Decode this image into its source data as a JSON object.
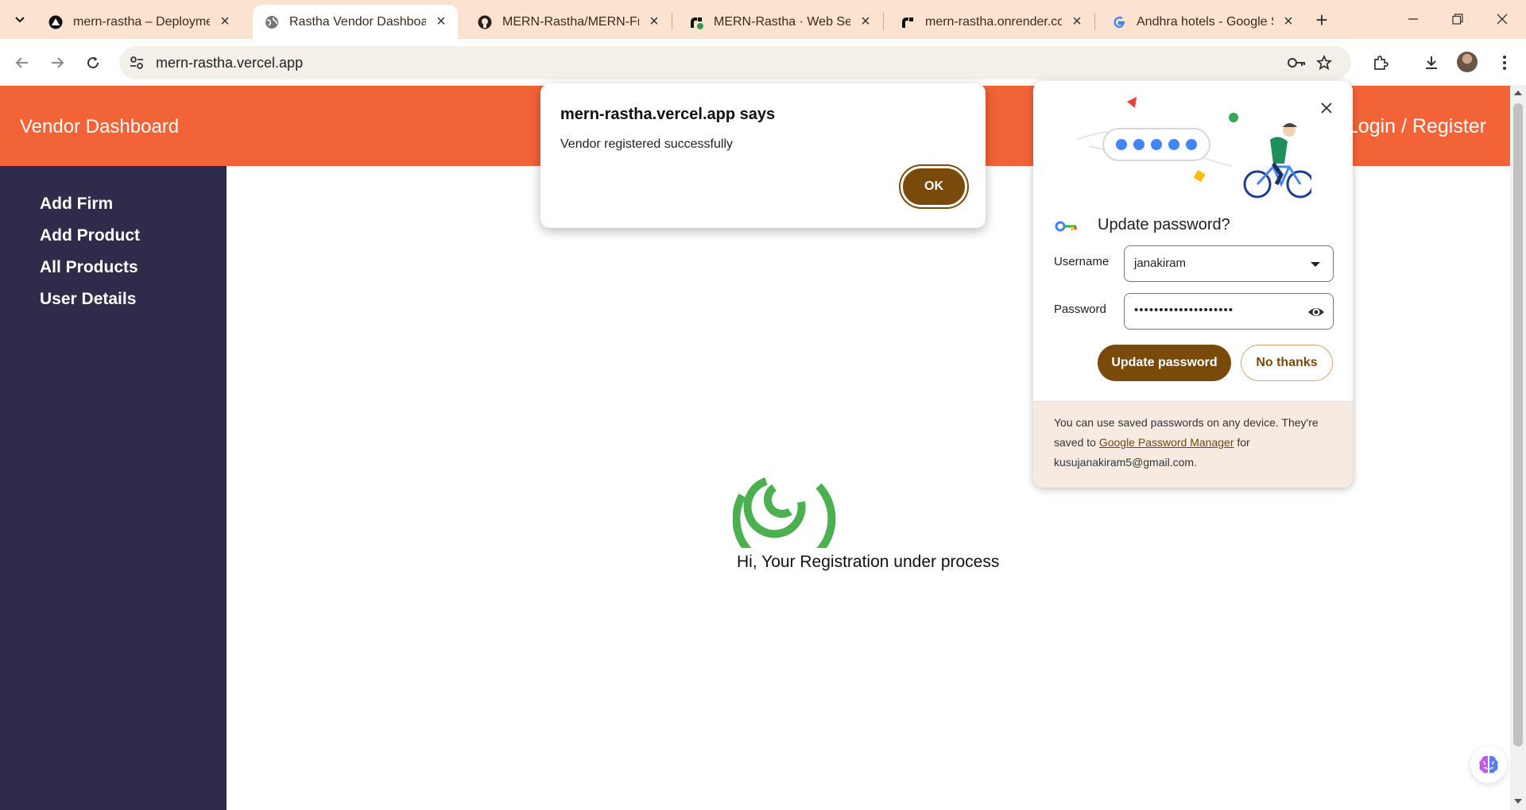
{
  "browser": {
    "tabs": [
      {
        "title": "mern-rastha – Deployment",
        "favicon": "vercel-icon"
      },
      {
        "title": "Rastha Vendor Dashboard",
        "favicon": "globe-icon",
        "active": true
      },
      {
        "title": "MERN-Rastha/MERN-Front",
        "favicon": "github-icon"
      },
      {
        "title": "MERN-Rastha · Web Servic",
        "favicon": "render-icon"
      },
      {
        "title": "mern-rastha.onrender.com",
        "favicon": "render-icon"
      },
      {
        "title": "Andhra hotels - Google Se",
        "favicon": "google-icon"
      }
    ],
    "url": "mern-rastha.vercel.app"
  },
  "page": {
    "brand": "Vendor Dashboard",
    "login": "Login / Register",
    "sidebar": [
      "Add Firm",
      "Add Product",
      "All Products",
      "User Details"
    ],
    "loader_color": "#4caf50",
    "registration_text": "Hi, Your Registration under process",
    "nav_color": "#f26337",
    "sidebar_color": "#2f2b4b"
  },
  "alert": {
    "title": "mern-rastha.vercel.app says",
    "message": "Vendor registered successfully",
    "ok_label": "OK"
  },
  "password_bubble": {
    "title": "Update password?",
    "username_label": "Username",
    "username_value": "janakiram",
    "password_label": "Password",
    "password_mask": "••••••••••••••••••••",
    "update_label": "Update password",
    "no_thanks_label": "No thanks",
    "footer": {
      "pre": "You can use saved passwords on any device. They're saved to ",
      "link": "Google Password Manager",
      "post": " for kusujanakiram5@gmail.com."
    }
  }
}
